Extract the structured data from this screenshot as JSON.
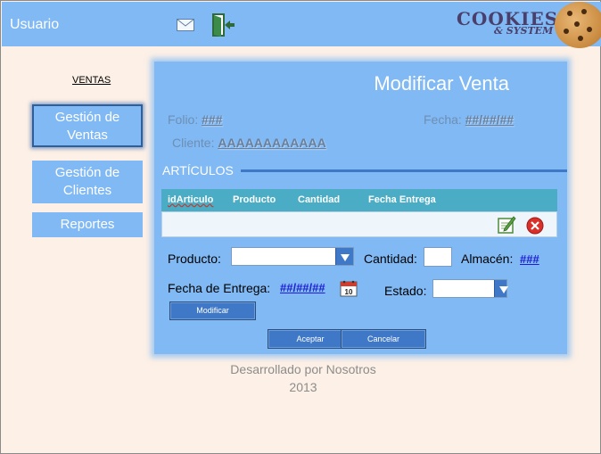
{
  "header": {
    "user_label": "Usuario",
    "logo_line1": "COOKIES",
    "logo_line2": "& SYSTEM"
  },
  "sidebar": {
    "title": "VENTAS",
    "items": [
      {
        "label_line1": "Gestión de",
        "label_line2": "Ventas",
        "active": true
      },
      {
        "label_line1": "Gestión de",
        "label_line2": "Clientes",
        "active": false
      },
      {
        "label_line1": "Reportes",
        "label_line2": "",
        "active": false
      }
    ]
  },
  "panel": {
    "title": "Modificar Venta",
    "folio_label": "Folio:",
    "folio_value": "###",
    "fecha_label": "Fecha:",
    "fecha_value": "##/##/##",
    "cliente_label": "Cliente:",
    "cliente_value": "AAAAAAAAAAAA",
    "articulos_label": "ARTÍCULOS",
    "grid": {
      "columns": [
        "idArticulo",
        "Producto",
        "Cantidad",
        "Fecha Entrega"
      ]
    },
    "form": {
      "producto_label": "Producto:",
      "producto_value": "",
      "cantidad_label": "Cantidad:",
      "cantidad_value": "",
      "almacen_label": "Almacén:",
      "almacen_value": "###",
      "fecha_entrega_label": "Fecha de Entrega:",
      "fecha_entrega_value": "##/##/##",
      "calendar_day": "10",
      "estado_label": "Estado:",
      "estado_value": ""
    },
    "buttons": {
      "modificar": "Modificar",
      "aceptar": "Aceptar",
      "cancelar": "Cancelar"
    }
  },
  "footer": {
    "line1": "Desarrollado por Nosotros",
    "line2": "2013"
  },
  "colors": {
    "accent": "#80b9f4",
    "dark_accent": "#3f78c6",
    "grid_header": "#4badc5",
    "background": "#fdf0e6"
  }
}
